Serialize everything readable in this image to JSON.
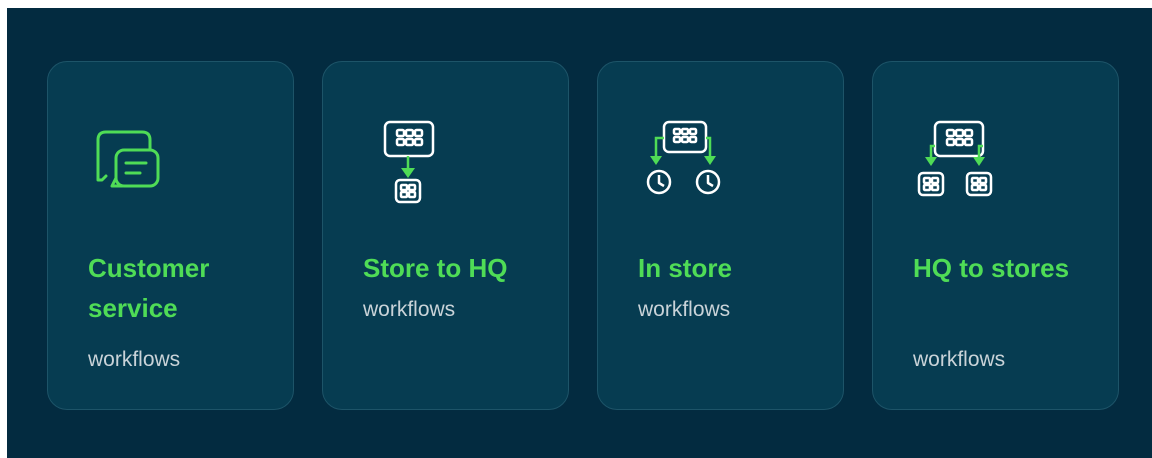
{
  "colors": {
    "background": "#032b40",
    "card": "#063c51",
    "card_border": "#1d5468",
    "accent": "#4fdc56",
    "subtitle": "#c9d3d8",
    "icon_stroke": "#ffffff"
  },
  "cards": [
    {
      "title": "Customer service",
      "subtitle": "workflows",
      "icon": "chat-bubbles-icon"
    },
    {
      "title": "Store to HQ",
      "subtitle": "workflows",
      "icon": "store-to-hq-icon"
    },
    {
      "title": "In store",
      "subtitle": "workflows",
      "icon": "in-store-clocks-icon"
    },
    {
      "title": "HQ to stores",
      "subtitle": "workflows",
      "icon": "hq-to-stores-icon"
    }
  ]
}
